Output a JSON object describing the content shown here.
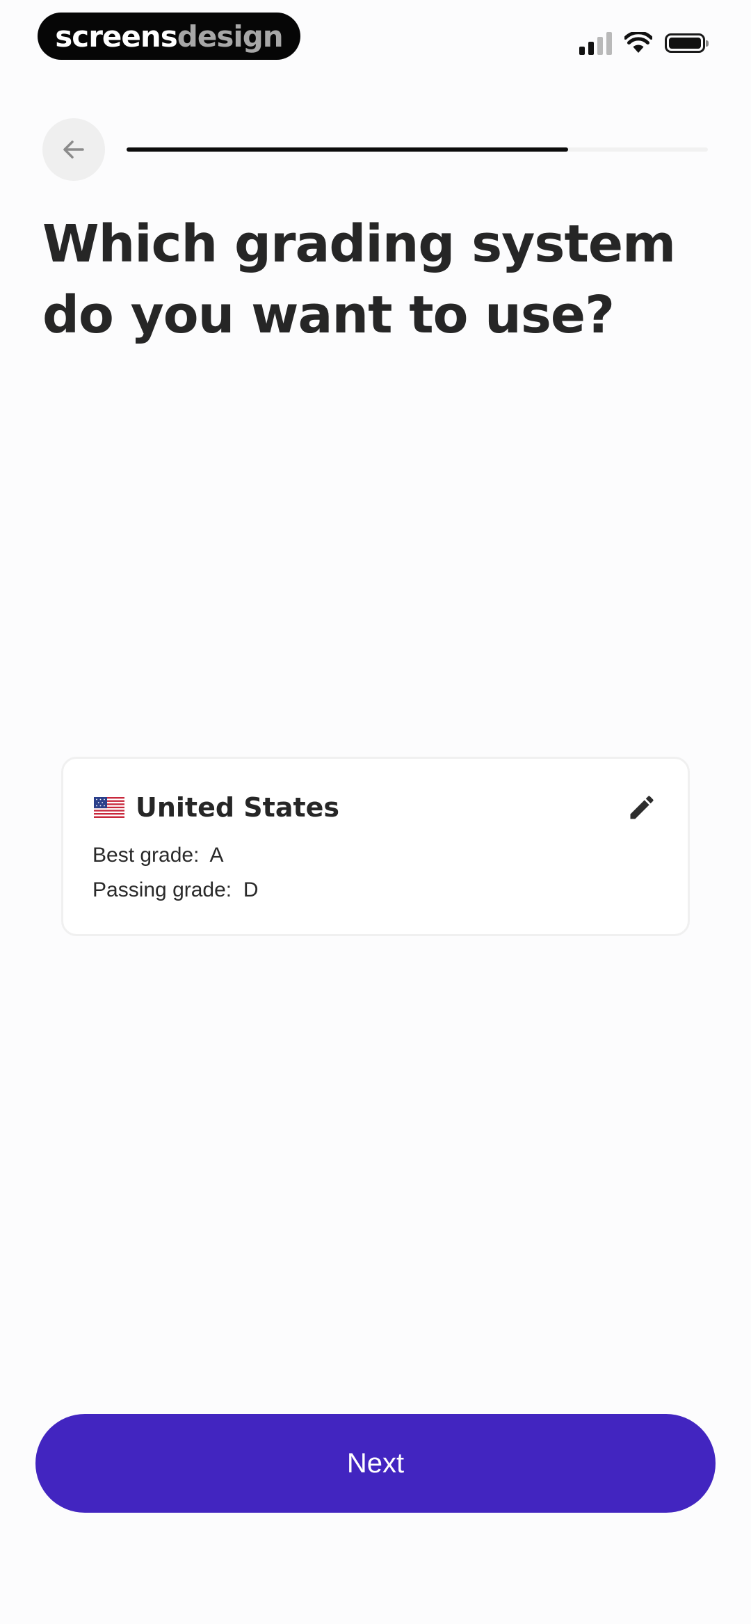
{
  "status_bar": {
    "brand_left": "screens",
    "brand_right": "design",
    "icons": [
      "cellular-signal-icon",
      "wifi-icon",
      "battery-icon"
    ]
  },
  "navigation": {
    "back_icon": "arrow-left-icon",
    "progress_fraction": 0.76
  },
  "question": {
    "title": "Which grading system do you want to use?"
  },
  "grading_card": {
    "flag_icon": "us-flag-icon",
    "country": "United States",
    "edit_icon": "pencil-icon",
    "best_grade_label": "Best grade:",
    "best_grade_value": "A",
    "passing_grade_label": "Passing grade:",
    "passing_grade_value": "D"
  },
  "footer": {
    "next_label": "Next"
  },
  "colors": {
    "accent": "#4225c0",
    "progress": "#0c0c0c",
    "track": "#f1f1f1",
    "text": "#262626"
  }
}
